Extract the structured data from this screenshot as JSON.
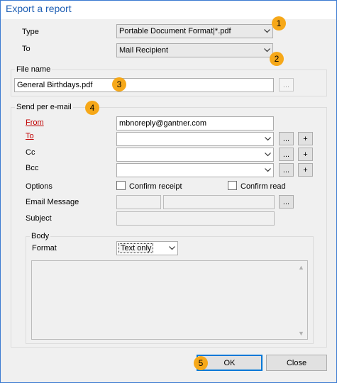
{
  "window": {
    "title": "Export a report"
  },
  "type_row": {
    "label": "Type",
    "value": "Portable Document Format|*.pdf"
  },
  "to_row": {
    "label": "To",
    "value": "Mail Recipient"
  },
  "file_name_group": {
    "title": "File name",
    "value": "General Birthdays.pdf",
    "browse_label": "..."
  },
  "send_group": {
    "title": "Send per e-mail",
    "from_label": "From",
    "from_value": "mbnoreply@gantner.com",
    "to_label": "To",
    "cc_label": "Cc",
    "bcc_label": "Bcc",
    "options_label": "Options",
    "confirm_receipt_label": "Confirm receipt",
    "confirm_read_label": "Confirm read",
    "email_message_label": "Email Message",
    "subject_label": "Subject",
    "ellipsis": "...",
    "plus": "+"
  },
  "body_group": {
    "title": "Body",
    "format_label": "Format",
    "format_value": "Text only"
  },
  "buttons": {
    "ok": "OK",
    "close": "Close"
  },
  "badges": [
    "1",
    "2",
    "3",
    "4",
    "5"
  ],
  "colors": {
    "accent": "#1f5fb4",
    "badge": "#f6a819",
    "required": "#c00000"
  }
}
